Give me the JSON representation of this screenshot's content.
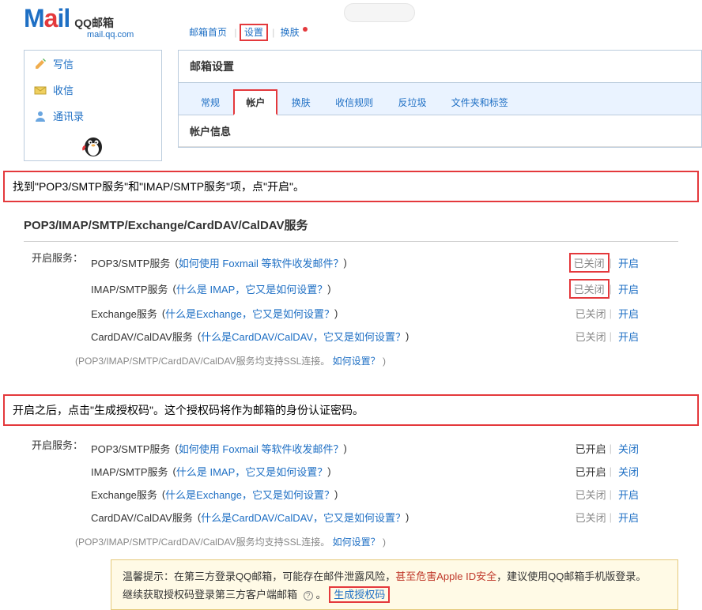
{
  "header": {
    "logo_text": "Mail",
    "brand_cn": "QQ邮箱",
    "domain": "mail.qq.com",
    "nav_home": "邮箱首页",
    "nav_settings": "设置",
    "nav_skin": "换肤"
  },
  "sidebar": {
    "compose": "写信",
    "inbox": "收信",
    "contacts": "通讯录"
  },
  "main": {
    "title": "邮箱设置",
    "tabs": [
      "常规",
      "帐户",
      "换肤",
      "收信规则",
      "反垃圾",
      "文件夹和标签"
    ],
    "sub_head": "帐户信息"
  },
  "instr1": "找到\"POP3/SMTP服务\"和\"IMAP/SMTP服务\"项，点\"开启\"。",
  "services1": {
    "heading": "POP3/IMAP/SMTP/Exchange/CardDAV/CalDAV服务",
    "label": "开启服务：",
    "items": [
      {
        "name": "POP3/SMTP服务",
        "help": "如何使用 Foxmail 等软件收发邮件？",
        "status": "已关闭",
        "status_boxed": true,
        "action": "开启"
      },
      {
        "name": "IMAP/SMTP服务",
        "help": "什么是 IMAP，它又是如何设置？",
        "status": "已关闭",
        "status_boxed": true,
        "action": "开启"
      },
      {
        "name": "Exchange服务",
        "help": "什么是Exchange，它又是如何设置？",
        "status": "已关闭",
        "status_boxed": false,
        "action": "开启"
      },
      {
        "name": "CardDAV/CalDAV服务",
        "help": "什么是CardDAV/CalDAV，它又是如何设置？",
        "status": "已关闭",
        "status_boxed": false,
        "action": "开启"
      }
    ],
    "note_prefix": "(POP3/IMAP/SMTP/CardDAV/CalDAV服务均支持SSL连接。",
    "note_link": "如何设置？",
    "note_suffix": ")"
  },
  "instr2": "开启之后，点击\"生成授权码\"。这个授权码将作为邮箱的身份认证密码。",
  "services2": {
    "label": "开启服务：",
    "items": [
      {
        "name": "POP3/SMTP服务",
        "help": "如何使用 Foxmail 等软件收发邮件？",
        "status": "已开启",
        "action": "关闭"
      },
      {
        "name": "IMAP/SMTP服务",
        "help": "什么是 IMAP，它又是如何设置？",
        "status": "已开启",
        "action": "关闭"
      },
      {
        "name": "Exchange服务",
        "help": "什么是Exchange，它又是如何设置？",
        "status": "已关闭",
        "action": "开启"
      },
      {
        "name": "CardDAV/CalDAV服务",
        "help": "什么是CardDAV/CalDAV，它又是如何设置？",
        "status": "已关闭",
        "action": "开启"
      }
    ],
    "note_prefix": "(POP3/IMAP/SMTP/CardDAV/CalDAV服务均支持SSL连接。",
    "note_link": "如何设置？",
    "note_suffix": ")"
  },
  "warm": {
    "prefix": "温馨提示：在第三方登录QQ邮箱，可能存在邮件泄露风险，",
    "danger": "甚至危害Apple ID安全",
    "suffix": "，建议使用QQ邮箱手机版登录。",
    "line2_prefix": "继续获取授权码登录第三方客户端邮箱",
    "info_glyph": "?",
    "dot": "。",
    "gen_link": "生成授权码"
  }
}
